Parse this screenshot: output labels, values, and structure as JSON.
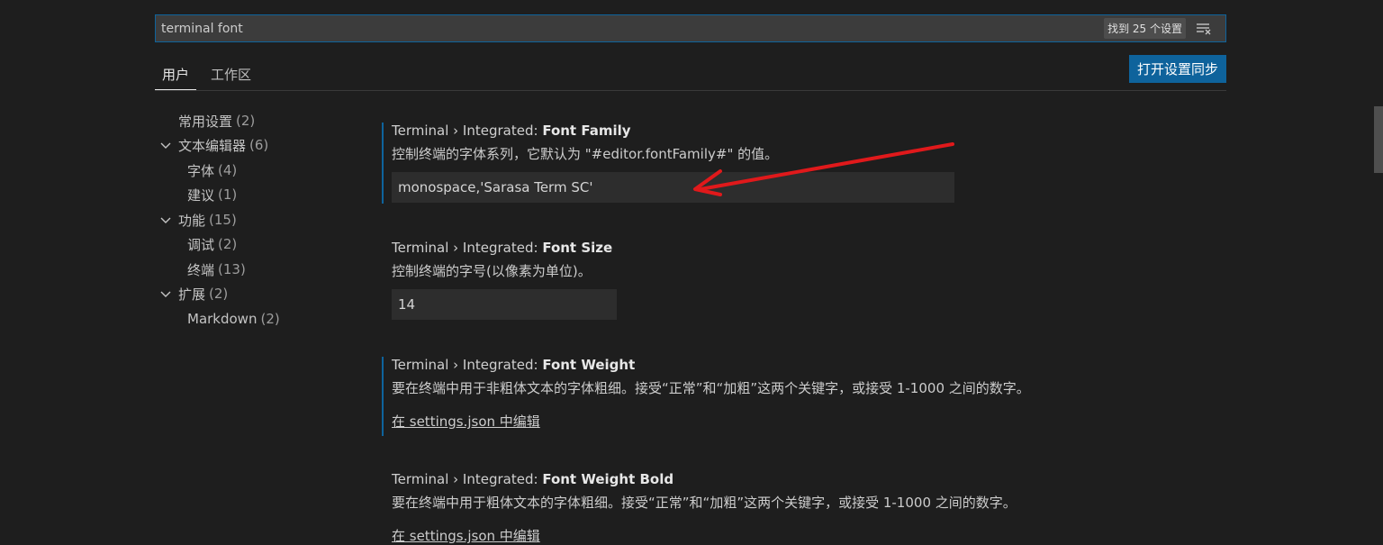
{
  "search": {
    "value": "terminal font",
    "result_count": "找到 25 个设置",
    "clear_icon": "clear-filter-icon"
  },
  "tabs": [
    {
      "label": "用户",
      "active": true
    },
    {
      "label": "工作区",
      "active": false
    }
  ],
  "sync_button": "打开设置同步",
  "toc": [
    {
      "label": "常用设置",
      "count": "(2)"
    },
    {
      "label": "文本编辑器",
      "count": "(6)",
      "expanded": true
    },
    {
      "label": "字体",
      "count": "(4)"
    },
    {
      "label": "建议",
      "count": "(1)"
    },
    {
      "label": "功能",
      "count": "(15)",
      "expanded": true
    },
    {
      "label": "调试",
      "count": "(2)"
    },
    {
      "label": "终端",
      "count": "(13)"
    },
    {
      "label": "扩展",
      "count": "(2)",
      "expanded": true
    },
    {
      "label": "Markdown",
      "count": "(2)"
    }
  ],
  "settings": [
    {
      "category": "Terminal › Integrated: ",
      "name": "Font Family",
      "description": "控制终端的字体系列，它默认为 \"#editor.fontFamily#\" 的值。",
      "value": "monospace,'Sarasa Term SC'"
    },
    {
      "category": "Terminal › Integrated: ",
      "name": "Font Size",
      "description": "控制终端的字号(以像素为单位)。",
      "value": "14"
    },
    {
      "category": "Terminal › Integrated: ",
      "name": "Font Weight",
      "description": "要在终端中用于非粗体文本的字体粗细。接受“正常”和“加粗”这两个关键字，或接受 1-1000 之间的数字。",
      "link": "在 settings.json 中编辑"
    },
    {
      "category": "Terminal › Integrated: ",
      "name": "Font Weight Bold",
      "description": "要在终端中用于粗体文本的字体粗细。接受“正常”和“加粗”这两个关键字，或接受 1-1000 之间的数字。",
      "link": "在 settings.json 中编辑"
    }
  ],
  "colors": {
    "background": "#1e1e1e",
    "accent": "#0e639c",
    "annotation_arrow": "#e0191b"
  }
}
